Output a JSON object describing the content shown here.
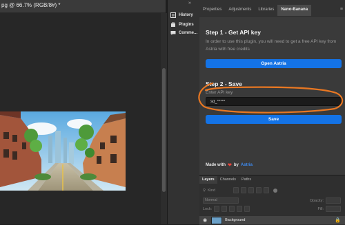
{
  "document": {
    "tab_label": "pg @ 66.7% (RGB/8#) *"
  },
  "side_strip": {
    "items": [
      {
        "label": "History",
        "icon": "history-icon"
      },
      {
        "label": "Plugins",
        "icon": "plugins-icon"
      },
      {
        "label": "Comme...",
        "icon": "comments-icon"
      }
    ]
  },
  "panel": {
    "tabs": [
      "Properties",
      "Adjustments",
      "Libraries",
      "Nano-Banana"
    ],
    "active_tab": "Nano-Banana",
    "step1_title": "Step 1 - Get API key",
    "step1_desc": "In order to use this plugin, you will need to get a free API key from Astria with free credits",
    "open_button": "Open Astria",
    "step2_title": "Step 2 - Save",
    "api_label": "Enter API key",
    "api_value": "sd_*****",
    "save_button": "Save",
    "made_with": "Made with",
    "by": "by",
    "made_link": "Astria",
    "accent_color": "#1473e6",
    "annotation_color": "#e87722"
  },
  "layers": {
    "tabs": [
      "Layers",
      "Channels",
      "Paths"
    ],
    "kind_label": "Kind",
    "blend_mode": "Normal",
    "opacity_label": "Opacity:",
    "lock_label": "Lock:",
    "fill_label": "Fill:",
    "layer_name": "Background"
  }
}
